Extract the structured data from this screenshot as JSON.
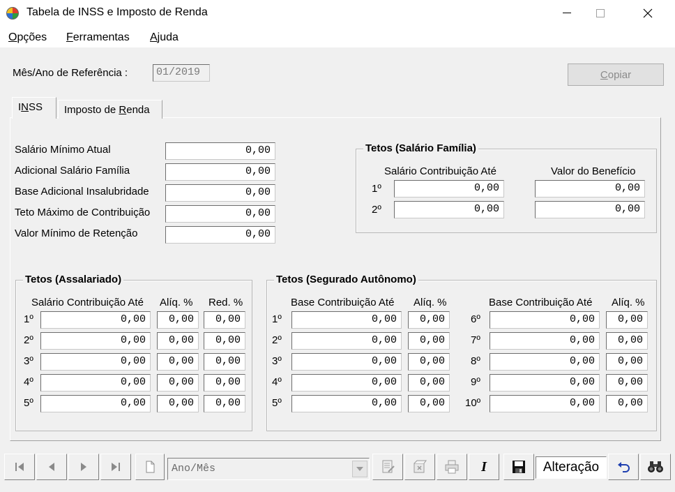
{
  "window": {
    "title": "Tabela de INSS e Imposto de Renda",
    "minimize": "—",
    "maximize": "☐",
    "close": "✕"
  },
  "menu": {
    "opcoes": {
      "first": "O",
      "rest": "pções"
    },
    "ferramentas": {
      "first": "F",
      "rest": "erramentas"
    },
    "ajuda": {
      "first": "A",
      "rest": "juda"
    }
  },
  "reference": {
    "label": "Mês/Ano de Referência :",
    "value": "01/2019"
  },
  "copy_button": {
    "first": "C",
    "rest": "opiar"
  },
  "tabs": {
    "inss": {
      "pre": "I",
      "underline": "N",
      "post": "SS"
    },
    "ir": {
      "pre": "Imposto de ",
      "underline": "R",
      "post": "enda"
    }
  },
  "general": [
    {
      "label": "Salário Mínimo Atual",
      "value": "0,00"
    },
    {
      "label": "Adicional Salário Família",
      "value": "0,00"
    },
    {
      "label": "Base Adicional Insalubridade",
      "value": "0,00"
    },
    {
      "label": "Teto Máximo de Contribuição",
      "value": "0,00"
    },
    {
      "label": "Valor Mínimo de Retenção",
      "value": "0,00"
    }
  ],
  "family": {
    "title": "Tetos (Salário Família)",
    "col1": "Salário Contribuição Até",
    "col2": "Valor do Benefício",
    "rows": [
      {
        "ord": "1º",
        "salario": "0,00",
        "beneficio": "0,00"
      },
      {
        "ord": "2º",
        "salario": "0,00",
        "beneficio": "0,00"
      }
    ]
  },
  "assalariado": {
    "title": "Tetos (Assalariado)",
    "col1": "Salário Contribuição Até",
    "col2": "Alíq. %",
    "col3": "Red. %",
    "rows": [
      {
        "ord": "1º",
        "salario": "0,00",
        "aliq": "0,00",
        "red": "0,00"
      },
      {
        "ord": "2º",
        "salario": "0,00",
        "aliq": "0,00",
        "red": "0,00"
      },
      {
        "ord": "3º",
        "salario": "0,00",
        "aliq": "0,00",
        "red": "0,00"
      },
      {
        "ord": "4º",
        "salario": "0,00",
        "aliq": "0,00",
        "red": "0,00"
      },
      {
        "ord": "5º",
        "salario": "0,00",
        "aliq": "0,00",
        "red": "0,00"
      }
    ]
  },
  "autonomo": {
    "title": "Tetos (Segurado Autônomo)",
    "col_base": "Base Contribuição Até",
    "col_aliq": "Alíq. %",
    "left": [
      {
        "ord": "1º",
        "base": "0,00",
        "aliq": "0,00"
      },
      {
        "ord": "2º",
        "base": "0,00",
        "aliq": "0,00"
      },
      {
        "ord": "3º",
        "base": "0,00",
        "aliq": "0,00"
      },
      {
        "ord": "4º",
        "base": "0,00",
        "aliq": "0,00"
      },
      {
        "ord": "5º",
        "base": "0,00",
        "aliq": "0,00"
      }
    ],
    "right": [
      {
        "ord": "6º",
        "base": "0,00",
        "aliq": "0,00"
      },
      {
        "ord": "7º",
        "base": "0,00",
        "aliq": "0,00"
      },
      {
        "ord": "8º",
        "base": "0,00",
        "aliq": "0,00"
      },
      {
        "ord": "9º",
        "base": "0,00",
        "aliq": "0,00"
      },
      {
        "ord": "10º",
        "base": "0,00",
        "aliq": "0,00"
      }
    ]
  },
  "toolbar": {
    "combo_value": "Ano/Mês",
    "italic_label": "I",
    "status": "Alteração"
  },
  "icons": [
    "first-record-icon",
    "prev-record-icon",
    "next-record-icon",
    "last-record-icon",
    "new-document-icon",
    "dropdown-arrow-icon",
    "edit-document-icon",
    "delete-icon",
    "print-icon",
    "italic-icon",
    "save-icon",
    "undo-icon",
    "binoculars-icon"
  ]
}
